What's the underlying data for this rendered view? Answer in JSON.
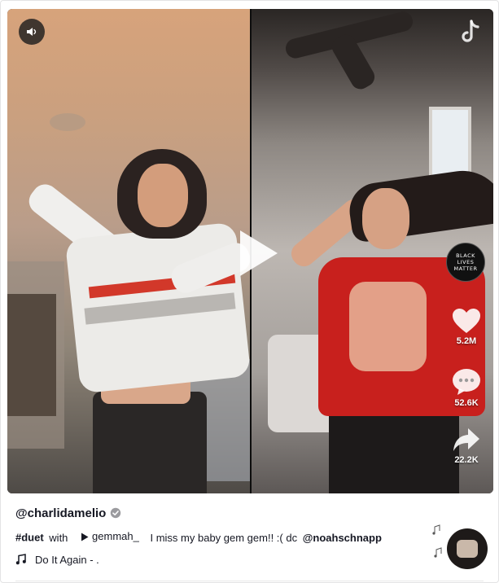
{
  "video": {
    "sound_icon": "speaker-icon",
    "logo_icon": "tiktok-logo-icon",
    "play_icon": "play-icon",
    "badge_lines": [
      "BLACK",
      "LIVES",
      "MATTER"
    ],
    "actions": [
      {
        "icon": "heart-icon",
        "count": "5.2M"
      },
      {
        "icon": "comment-icon",
        "count": "52.6K"
      },
      {
        "icon": "share-icon",
        "count": "22.2K"
      }
    ]
  },
  "post": {
    "username": "@charlidamelio",
    "verified_icon": "verified-check-icon",
    "hashtag": "#duet",
    "with_text": "with",
    "duet_user": "gemmah_",
    "caption": "I miss my baby gem gem!! :( dc",
    "mention": "@noahschnapp",
    "music_icon": "music-note-icon",
    "music_title": "Do It Again - ."
  },
  "colors": {
    "text": "#161823",
    "overlay_bg": "#1e1e1e",
    "shirt_red": "#c8201d"
  }
}
